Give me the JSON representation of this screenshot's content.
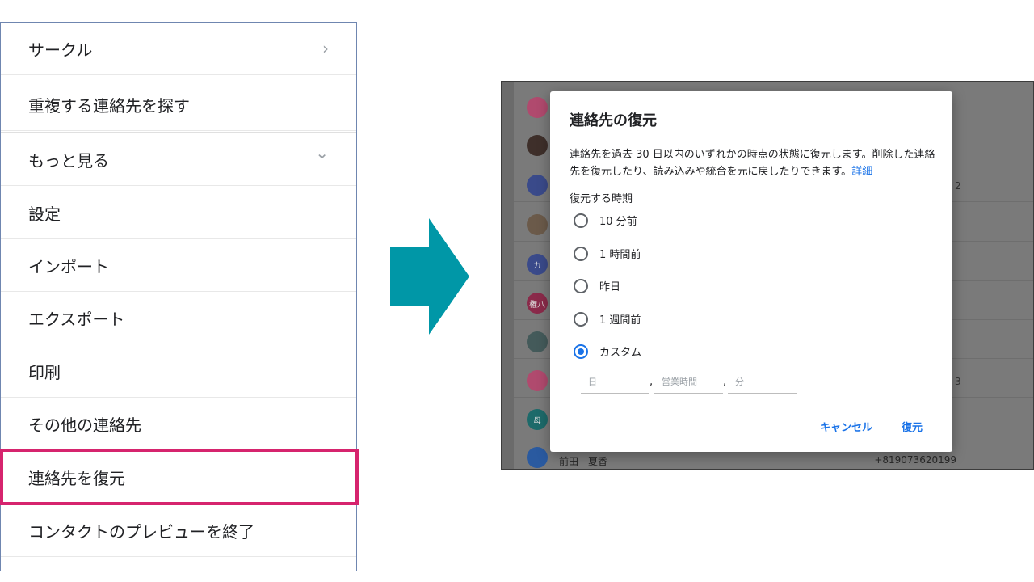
{
  "menu": {
    "items": [
      {
        "label": "サークル",
        "trail": "›"
      },
      {
        "label": "重複する連絡先を探す"
      },
      {
        "label": "もっと見る",
        "trail": "⌄"
      },
      {
        "label": "設定"
      },
      {
        "label": "インポート"
      },
      {
        "label": "エクスポート"
      },
      {
        "label": "印刷"
      },
      {
        "label": "その他の連絡先"
      },
      {
        "label": "連絡先を復元"
      },
      {
        "label": "コンタクトのプレビューを終了"
      }
    ],
    "highlight_color": "#d6246e"
  },
  "arrow": {
    "color": "#0097a7"
  },
  "background_list": {
    "avatars": [
      "",
      "",
      "",
      "",
      "カ",
      "権八",
      "",
      "",
      "母",
      ""
    ],
    "avatar_colors": [
      "#b04a6e",
      "#3e2f2a",
      "#3a4a8a",
      "#6b5a4a",
      "#3a4a8a",
      "#8a2a4a",
      "#445a5a",
      "#b04a6e",
      "#1d6a6a",
      "#2a5aa0"
    ],
    "fragments": [
      "2",
      "3"
    ],
    "last_row": {
      "name": "前田　夏香",
      "phone": "+819073620199"
    }
  },
  "dialog": {
    "title": "連絡先の復元",
    "description": "連絡先を過去 30 日以内のいずれかの時点の状態に復元します。削除した連絡先を復元したり、読み込みや統合を元に戻したりできます。",
    "link": "詳細",
    "subtitle": "復元する時期",
    "options": [
      {
        "label": "10 分前",
        "selected": false
      },
      {
        "label": "1 時間前",
        "selected": false
      },
      {
        "label": "昨日",
        "selected": false
      },
      {
        "label": "1 週間前",
        "selected": false
      },
      {
        "label": "カスタム",
        "selected": true
      }
    ],
    "custom_fields": {
      "day_placeholder": "日",
      "hours_placeholder": "営業時間",
      "minutes_placeholder": "分",
      "separator": ","
    },
    "cancel_label": "キャンセル",
    "restore_label": "復元",
    "accent_color": "#1a73e8"
  }
}
